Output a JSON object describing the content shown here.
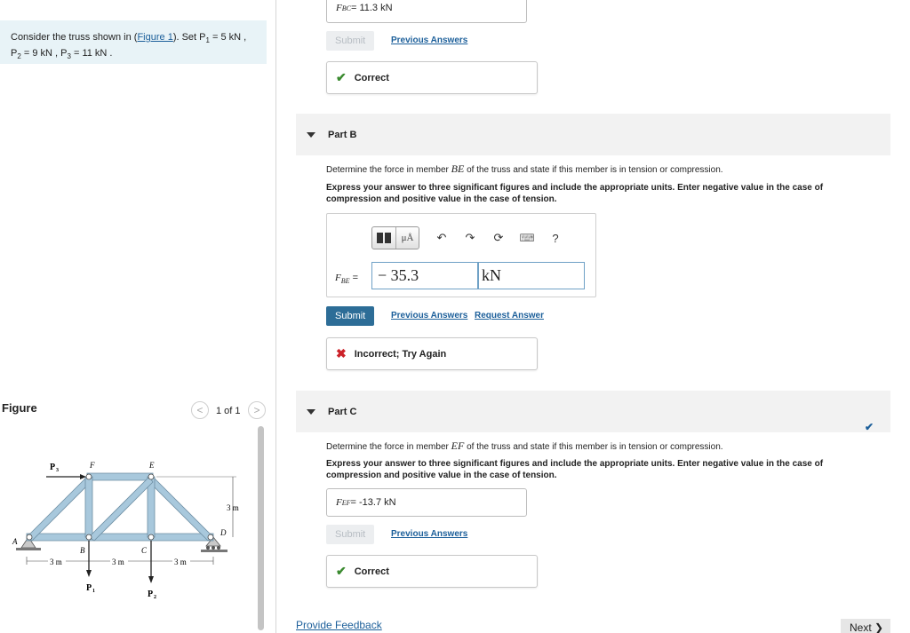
{
  "problem": {
    "intro": "Consider the truss shown in (",
    "figure_link": "Figure 1",
    "after_link": "). Set P",
    "p1_sub": "1",
    "p1_value": " = 5  kN ,",
    "p2": "P",
    "p2_sub": "2",
    "p2_value": " = 9  kN , ",
    "p3": "P",
    "p3_sub": "3",
    "p3_value": " = 11  kN ."
  },
  "figure_panel": {
    "title": "Figure",
    "prev": "<",
    "next": ">",
    "count": "1 of 1",
    "labels": {
      "P3": "P",
      "P3_sub": "3",
      "F": "F",
      "E": "E",
      "A": "A",
      "B": "B",
      "C": "C",
      "D": "D",
      "dim_3m_vertical": "3 m",
      "dim_3m_1": "3 m",
      "dim_3m_2": "3 m",
      "dim_3m_3": "3 m",
      "P1": "P",
      "P1_sub": "1",
      "P2": "P",
      "P2_sub": "2"
    }
  },
  "part_a": {
    "answer_var": "F",
    "answer_sub": "BC",
    "answer_text": " =  11.3 kN",
    "submit_label": "Submit",
    "previous_answers": "Previous Answers",
    "feedback": "Correct"
  },
  "part_b": {
    "label": "Part B",
    "question_pre": "Determine the force in member ",
    "member": "BE",
    "question_post": " of the truss and state if this member is in tension or compression.",
    "instructions": "Express your answer to three significant figures and include the appropriate units. Enter negative value in the case of compression and positive value in the case of tension.",
    "toolbar": {
      "templates": "▯▯",
      "units": "μÅ",
      "undo": "↶",
      "redo": "↷",
      "reset": "⟳",
      "keyboard": "⌨",
      "help": "?"
    },
    "var": "F",
    "var_sub": "BE",
    "equals": " =",
    "value": "− 35.3",
    "units": "kN",
    "submit_label": "Submit",
    "previous_answers": "Previous Answers",
    "request_answer": "Request Answer",
    "feedback": "Incorrect; Try Again"
  },
  "part_c": {
    "label": "Part C",
    "question_pre": "Determine the force in member ",
    "member": "EF",
    "question_post": " of the truss and state if this member is in tension or compression.",
    "instructions": "Express your answer to three significant figures and include the appropriate units. Enter negative value in the case of compression and positive value in the case of tension.",
    "answer_var": "F",
    "answer_sub": "EF",
    "answer_text": " =  -13.7 kN",
    "submit_label": "Submit",
    "previous_answers": "Previous Answers",
    "feedback": "Correct",
    "check": "✔"
  },
  "footer": {
    "provide_feedback": "Provide Feedback",
    "next": "Next ❯"
  },
  "colors": {
    "correct": "#3a8a2f",
    "incorrect": "#cc2229",
    "link": "#1c5f9a",
    "submit_bg": "#2d6d97",
    "problem_bg": "#e8f3f7",
    "truss_member": "#a8c8dc"
  }
}
